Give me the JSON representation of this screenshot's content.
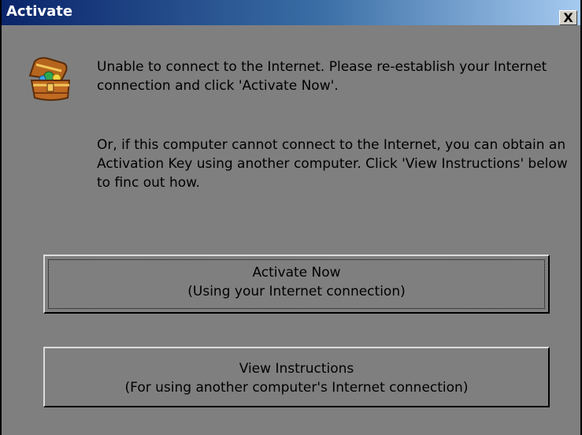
{
  "window": {
    "title": "Activate",
    "close_glyph": "X"
  },
  "icon": {
    "name": "treasure-chest-icon"
  },
  "message": {
    "line1": "Unable to connect to the Internet. Please re-establish your Internet connection and click 'Activate Now'.",
    "line2": "Or, if this computer cannot connect to the Internet, you can obtain an Activation Key using another computer.  Click 'View Instructions' below to finc out how."
  },
  "buttons": {
    "activate": {
      "label": "Activate Now",
      "sublabel": "(Using your Internet connection)"
    },
    "view": {
      "label": "View Instructions",
      "sublabel": "(For using another computer's Internet connection)"
    }
  },
  "colors": {
    "title_gradient_start": "#0a246a",
    "title_gradient_end": "#a6caf0",
    "body_background": "#7f7f7f"
  }
}
